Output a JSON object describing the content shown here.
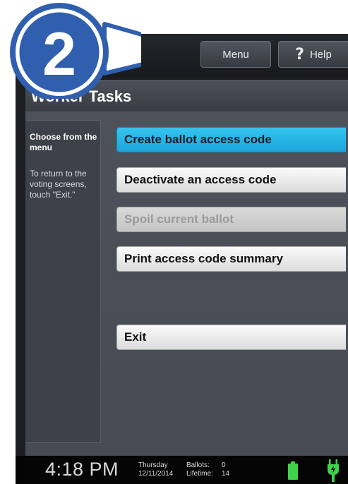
{
  "header": {
    "menu_label": "Menu",
    "help_label": "Help",
    "help_symbol": "?"
  },
  "title": "Worker Tasks",
  "callout_number": "2",
  "sidebar": {
    "heading": "Choose from the menu",
    "body": "To return to the voting screens, touch \"Exit.\""
  },
  "tasks": [
    {
      "label": "Create ballot access code",
      "state": "active"
    },
    {
      "label": "Deactivate an access code",
      "state": "normal"
    },
    {
      "label": "Spoil current ballot",
      "state": "disabled"
    },
    {
      "label": "Print access code summary",
      "state": "normal"
    },
    {
      "label": "Exit",
      "state": "normal"
    }
  ],
  "status": {
    "time": "4:18 PM",
    "day": "Thursday",
    "date": "12/11/2014",
    "ballots_label": "Ballots:",
    "ballots_value": "0",
    "lifetime_label": "Lifetime:",
    "lifetime_value": "14"
  },
  "colors": {
    "accent": "#1ba6db",
    "callout_blue": "#2f5fae",
    "battery_green": "#3fd24a"
  }
}
